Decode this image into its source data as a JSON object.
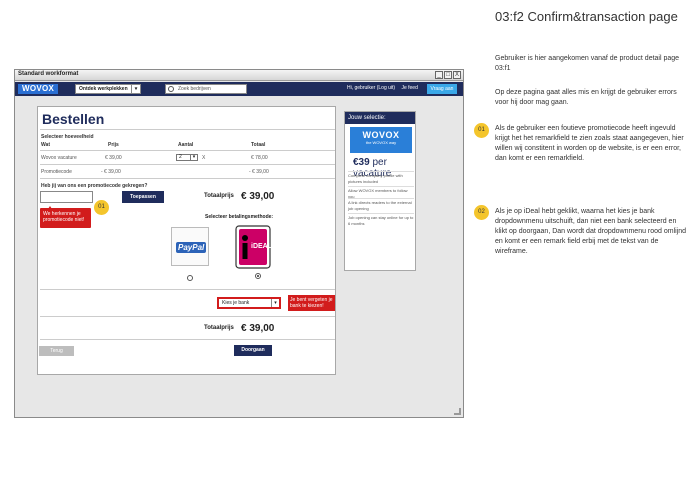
{
  "window": {
    "title": "Standard workformat",
    "btn_min": "_",
    "btn_max": "□",
    "btn_close": "X"
  },
  "appbar": {
    "logo": "WOVOX",
    "discover": "Ontdek werkplekken",
    "search_placeholder": "Zoek bedrijven",
    "greeting": "Hi, gebruiker (Log uit)",
    "link": "Je feed",
    "cta": "Vraag aan"
  },
  "checkout": {
    "title": "Bestellen",
    "select_label": "Selecteer hoeveelheid",
    "headers": {
      "wat": "Wat",
      "prijs": "Prijs",
      "aantal": "Aantal",
      "totaal": "Totaal"
    },
    "rows": [
      {
        "wat": "Wovox vacature",
        "prijs": "€ 39,00",
        "qty": "2",
        "x": "X",
        "totaal": "€ 78,00"
      },
      {
        "wat": "Promotiecode",
        "prijs": "- € 39,00",
        "totaal": "- € 39,00"
      }
    ],
    "promo_question": "Heb jij van ons een promotiecode gekregen?",
    "apply_button": "Toepassen",
    "promo_error": "We herkennen je promotiecode niet!",
    "total_label": "Totaalprijs",
    "total_value": "€ 39,00",
    "pay_method_label": "Selecteer betalingsmethode:",
    "paypal": "PayPal",
    "ideal": "iDEAL",
    "bank_select": "Kies je bank",
    "bank_error": "Je bent vergeten je bank te kiezen!",
    "total_label_2": "Totaalprijs",
    "total_value_2": "€ 39,00",
    "back_button": "Terug",
    "continue_button": "Doorgaan"
  },
  "selection": {
    "header": "Jouw selectie:",
    "brand": "WOVOX",
    "tagline": "the WOVOX way",
    "price_bold": "€39",
    "price_text": "per vacature",
    "features": [
      "Complete company profile with pictures included",
      "Allow WOVOX members to follow you",
      "A link directs readers to the external job opening",
      "Job opening can stay online for up to 6 months"
    ]
  },
  "markers": {
    "m1": "01",
    "m2": "02"
  },
  "notes": {
    "page_title": "03:f2 Confirm&transaction page",
    "intro": "Gebruiker is hier aangekomen vanaf de product detail page 03:f1",
    "errors": "Op deze pagina gaat alles mis en krijgt de gebruiker errors voor hij door mag gaan.",
    "n1_marker": "01",
    "n1": "Als de gebruiker een foutieve promotiecode heeft ingevuld krijgt het het remarkfield te zien zoals staat aangegeven, hier willen wij constitent in worden op de website, is er een error, dan komt er een remarkfield.",
    "n2_marker": "02",
    "n2": "Als je op iDeal hebt geklikt, waarna het kies je bank dropdownmenu uitschuift, dan niet een bank selecteerd en klikt op doorgaan, Dan wordt dat dropdownmenu rood omlijnd en komt er een remark field erbij met de tekst van de wireframe."
  },
  "colors": {
    "navy": "#1f2c5c",
    "brand_blue": "#2a7fd8",
    "error_red": "#d21c1c",
    "marker_yellow": "#f4c52c"
  }
}
